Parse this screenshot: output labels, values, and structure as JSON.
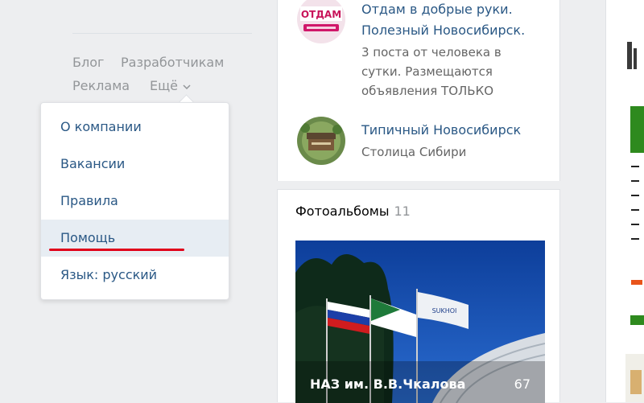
{
  "footer": {
    "links": [
      "Блог",
      "Разработчикам",
      "Реклама"
    ],
    "more_label": "Ещё"
  },
  "dropdown": {
    "items": [
      "О компании",
      "Вакансии",
      "Правила",
      "Помощь",
      "Язык: русский"
    ],
    "active_index": 3
  },
  "groups": [
    {
      "avatar_text": "ОТДАМ",
      "name": "Отдам в добрые руки.",
      "name_line2": "Полезный Новосибирск.",
      "desc": [
        "3 поста от человека в",
        "сутки. Размещаются",
        "объявления ТОЛЬКО"
      ]
    },
    {
      "name": "Типичный Новосибирск",
      "desc": [
        "Столица Сибири"
      ]
    }
  ],
  "photo_albums": {
    "title": "Фотоальбомы",
    "count": "11",
    "album": {
      "title": "НАЗ им. В.В.Чкалова",
      "count": "67",
      "flag_label": "SUKHOI"
    }
  },
  "colors": {
    "link": "#2a5885",
    "muted": "#939699",
    "active_bg": "#e7edf3",
    "underline": "#e0001a",
    "page_bg": "#edeef0"
  }
}
